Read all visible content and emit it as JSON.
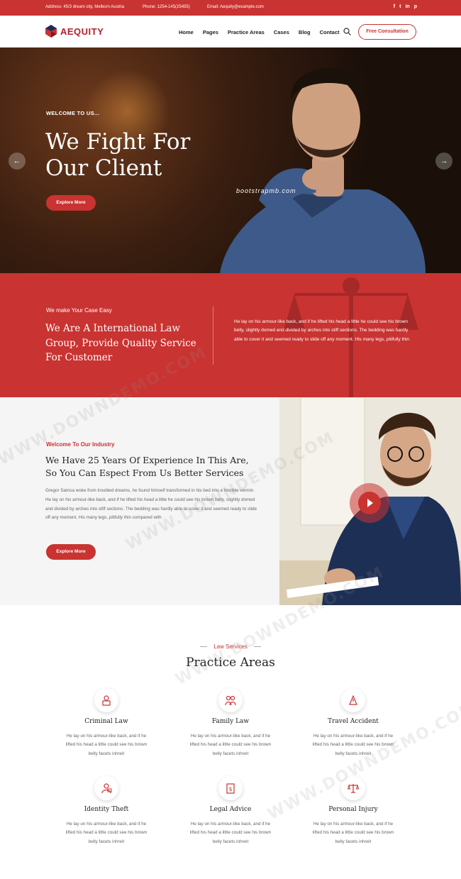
{
  "topbar": {
    "address": "Address: 45/3 dream city, Melborn Austria",
    "phone": "Phone: 1254-145(25455)",
    "email": "Email: Aequity@example.com",
    "social": [
      "f",
      "t",
      "in",
      "p"
    ]
  },
  "nav": {
    "brand": "AEQUITY",
    "menu": [
      "Home",
      "Pages",
      "Practice Areas",
      "Cases",
      "Blog",
      "Contact"
    ],
    "cta": "Free Consultation",
    "icons": [
      "logo-icon",
      "search-icon"
    ]
  },
  "hero": {
    "kicker": "WELCOME TO US...",
    "title": "We Fight For Our Client",
    "button": "Explore More",
    "watermark": "bootstrapmb.com",
    "arrows": [
      "arrow-left-icon",
      "arrow-right-icon"
    ]
  },
  "band": {
    "kicker": "We make Your Case Easy",
    "title": "We Are A International Law Group, Provide Quality Service For Customer",
    "text": "He lay on his armour-like back, and if he lifted his head a little he could see his brown belly, slightly domed and divided by arches into stiff sections. The bedding was hardly able to cover it and seemed ready to slide off any moment. His many legs, pitifully thin"
  },
  "welcome": {
    "kicker": "Welcome To Our Industry",
    "title": "We Have 25 Years Of Experience In This Are, So You Can Espect From Us Better Services",
    "text": "Gregor Samsa woke from troubled dreams, he found himself transformed in his bed into a horrible vermin. He lay on his armour-like back, and if he lifted his head a little he could see his brown belly, slightly domed and divided by arches into stiff sections. The bedding was hardly able to cover it and seemed ready to slide off any moment. His many legs, pitifully thin compared with",
    "button": "Explore More",
    "play_icon": "play-icon"
  },
  "practice": {
    "kicker": "Law Services",
    "title": "Practice Areas",
    "items": [
      {
        "name": "Criminal Law",
        "desc": "He lay on his armour-like back, and if he lifted his head a little could see his brown belly facets inhreit",
        "icon": "criminal-icon"
      },
      {
        "name": "Family Law",
        "desc": "He lay on his armour-like back, and if he lifted his head a little could see his brown belly facets inhreit",
        "icon": "family-icon"
      },
      {
        "name": "Travel Accident",
        "desc": "He lay on his armour-like back, and if he lifted his head a little could see his brown belly facets inhreit",
        "icon": "travel-icon"
      },
      {
        "name": "Identity Theft",
        "desc": "He lay on his armour-like back, and if he lifted his head a little could see his brown belly facets inhreit",
        "icon": "identity-icon"
      },
      {
        "name": "Legal Advice",
        "desc": "He lay on his armour-like back, and if he lifted his head a little could see his brown belly facets inhreit",
        "icon": "legal-icon"
      },
      {
        "name": "Personal Injury",
        "desc": "He lay on his armour-like back, and if he lifted his head a little could see his brown belly facets inhreit",
        "icon": "injury-icon"
      }
    ]
  },
  "watermarks": [
    "WWW.DOWNDEMO.COM"
  ],
  "colors": {
    "accent": "#c93331",
    "dark": "#222222"
  }
}
